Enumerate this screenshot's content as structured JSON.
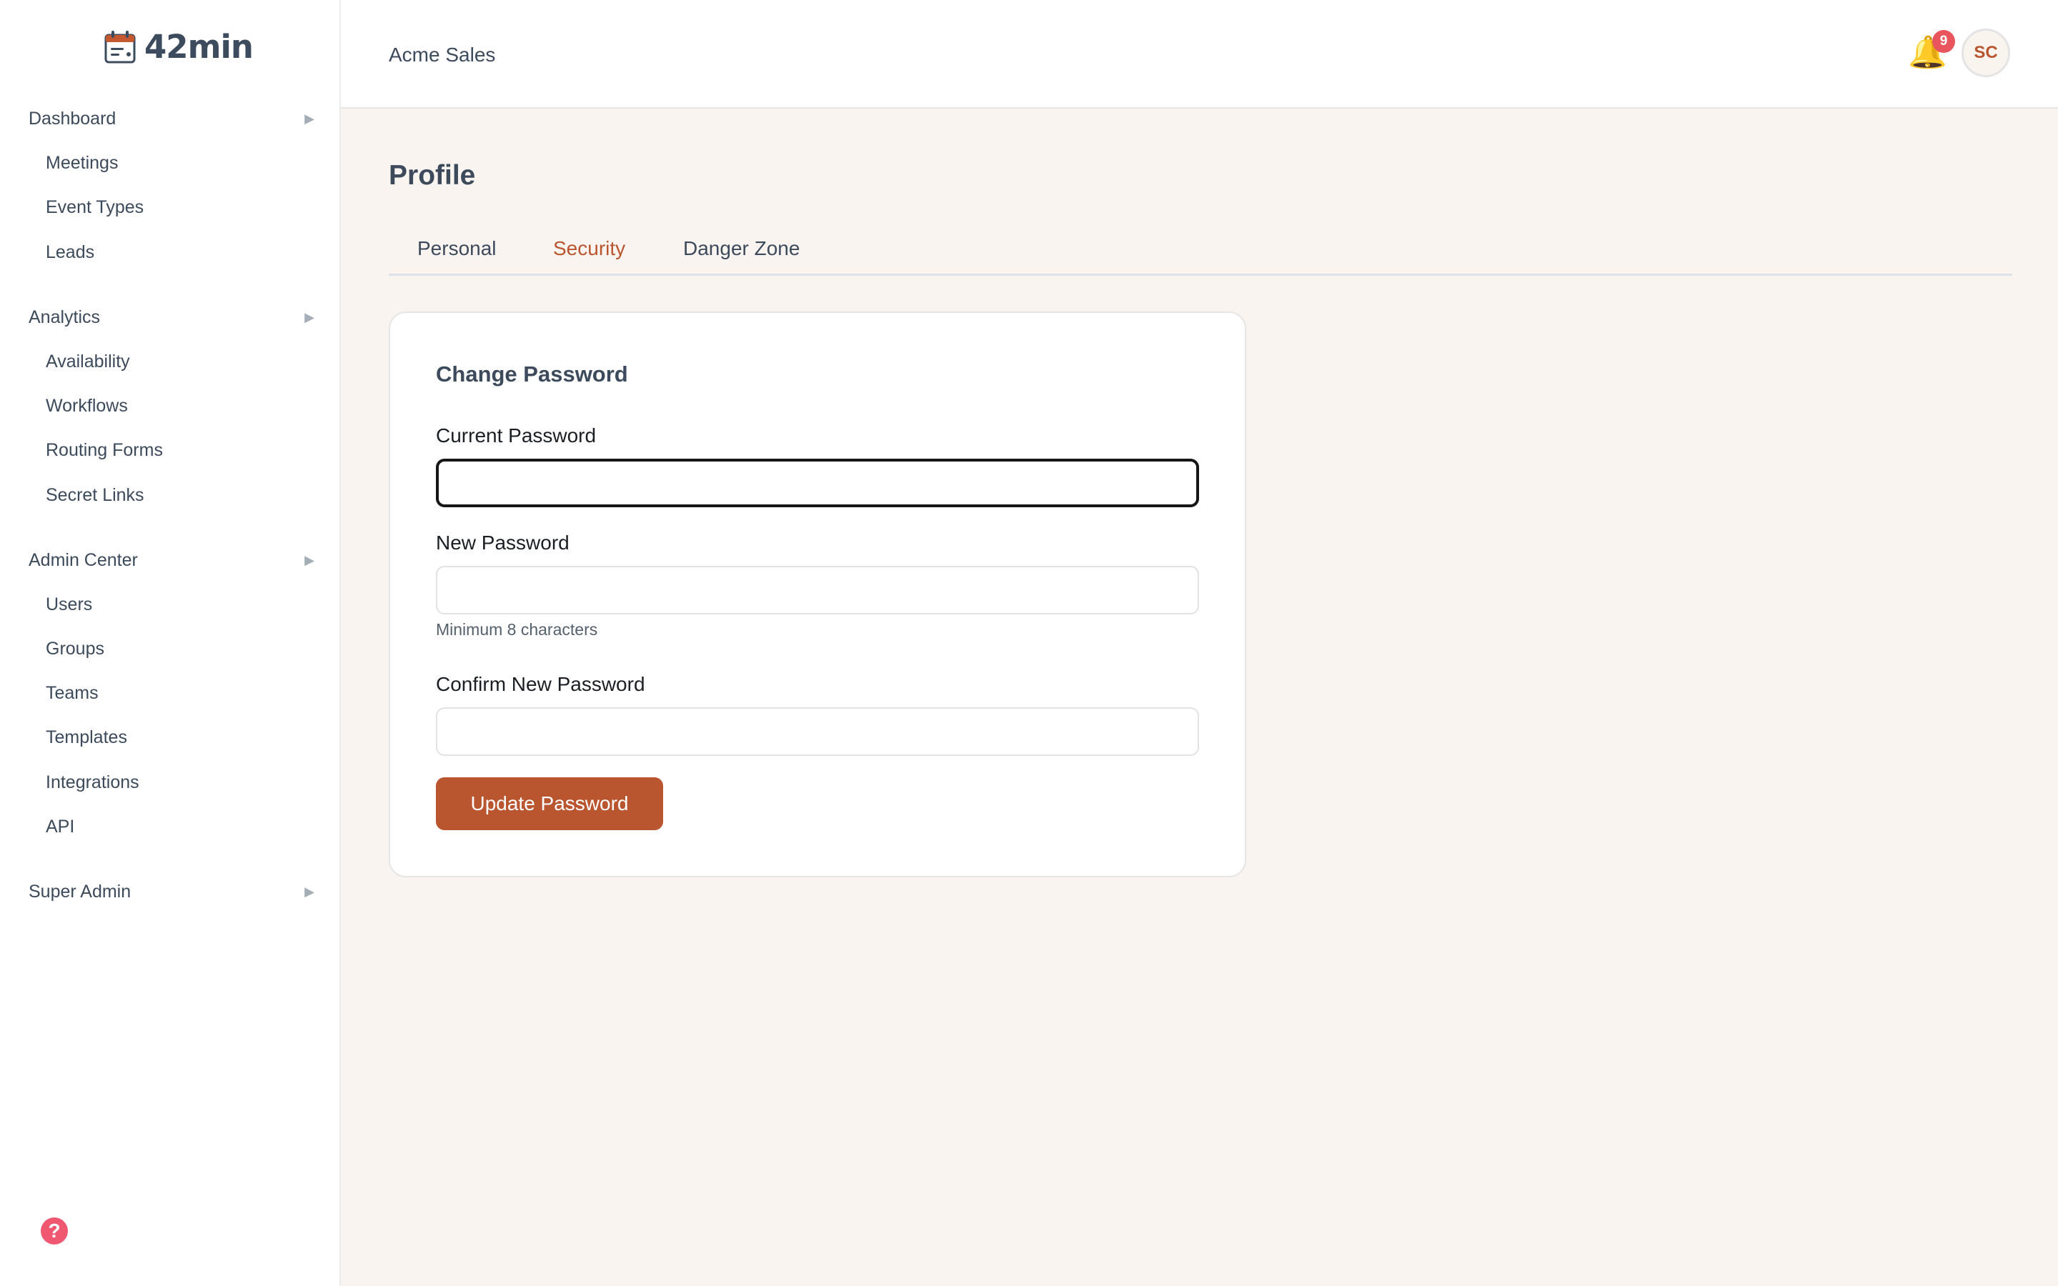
{
  "app": {
    "logo_text": "42min",
    "logo_icon": "calendar-icon"
  },
  "sidebar": {
    "sections": [
      {
        "label": "Dashboard",
        "items": [
          "Meetings",
          "Event Types",
          "Leads"
        ]
      },
      {
        "label": "Analytics",
        "items": [
          "Availability",
          "Workflows",
          "Routing Forms",
          "Secret Links"
        ]
      },
      {
        "label": "Admin Center",
        "items": [
          "Users",
          "Groups",
          "Teams",
          "Templates",
          "Integrations",
          "API"
        ]
      },
      {
        "label": "Super Admin",
        "items": []
      }
    ],
    "expand_arrow": "▶",
    "help_glyph": "?"
  },
  "header": {
    "org_name": "Acme Sales",
    "notification_count": "9",
    "avatar_initials": "SC"
  },
  "main": {
    "title": "Profile",
    "tabs": [
      {
        "label": "Personal",
        "active": false
      },
      {
        "label": "Security",
        "active": true
      },
      {
        "label": "Danger Zone",
        "active": false
      }
    ],
    "card": {
      "title": "Change Password",
      "fields": [
        {
          "label": "Current Password",
          "value": "",
          "placeholder": "",
          "focused": true
        },
        {
          "label": "New Password",
          "value": "",
          "placeholder": "",
          "hint": "Minimum 8 characters"
        },
        {
          "label": "Confirm New Password",
          "value": "",
          "placeholder": ""
        }
      ],
      "submit_label": "Update Password"
    }
  },
  "colors": {
    "accent": "#b9552f",
    "page_background": "#f9f4ef",
    "text": "#3c4a5c",
    "badge": "#e8555d",
    "help": "#ef5870"
  }
}
